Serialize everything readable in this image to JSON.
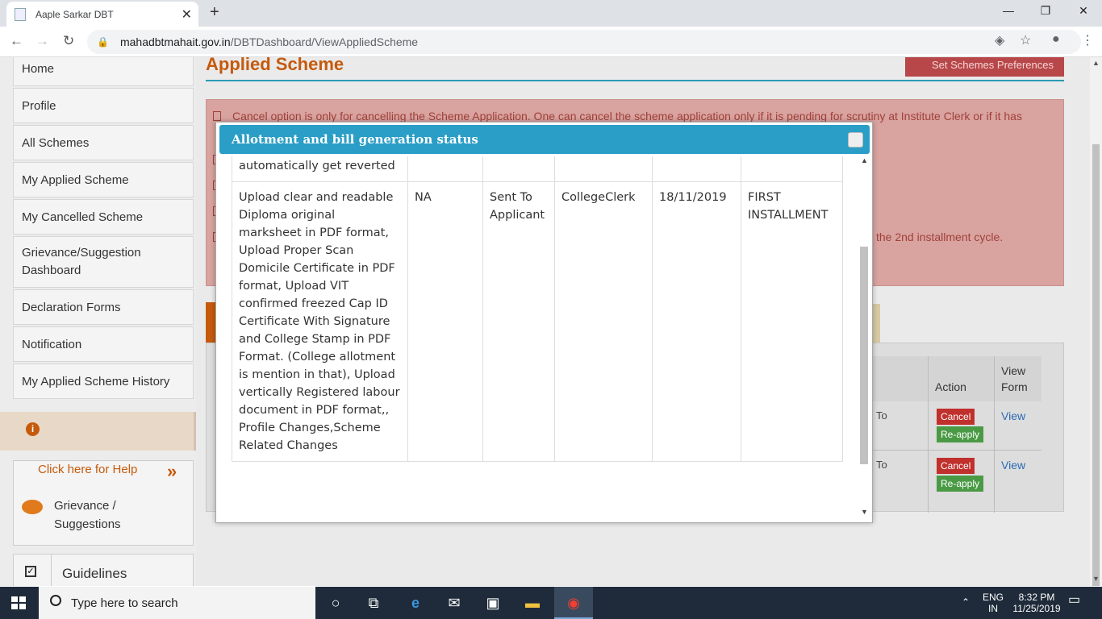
{
  "browser": {
    "tab_title": "Aaple Sarkar DBT",
    "tab_close": "✕",
    "new_tab": "+",
    "url_domain": "mahadbtmahait.gov.in",
    "url_path": "/DBTDashboard/ViewAppliedScheme",
    "window_controls": [
      "—",
      "❐",
      "✕"
    ]
  },
  "sidebar": {
    "items": [
      {
        "label": "Home"
      },
      {
        "label": "Profile"
      },
      {
        "label": "All Schemes"
      },
      {
        "label": "My Applied Scheme"
      },
      {
        "label": "My Cancelled Scheme"
      },
      {
        "label": "Grievance/Suggestion Dashboard"
      },
      {
        "label": "Declaration Forms"
      },
      {
        "label": "Notification"
      },
      {
        "label": "My Applied Scheme History"
      }
    ],
    "help_link": "Click here for Help",
    "help_arrow": "»",
    "grievance_label": "Grievance / Suggestions",
    "guidelines_label": "Guidelines"
  },
  "main": {
    "page_title": "Applied Scheme",
    "prefs_button": "Set Schemes Preferences",
    "notice_text": "Cancel option is only for cancelling the Scheme Application. One can cancel the scheme application only if it is pending for scrutiny at Institute Clerk or if it has",
    "notice_text_2": "the 2nd installment cycle.",
    "table": {
      "headers": {
        "action": "Action",
        "view_form": "View Form"
      },
      "rows": [
        {
          "status_fragment": "To",
          "cancel": "Cancel",
          "reapply": "Re-apply",
          "view": "View"
        },
        {
          "status_fragment": "To",
          "cancel": "Cancel",
          "reapply": "Re-apply",
          "view": "View"
        }
      ]
    }
  },
  "modal": {
    "title": "Allotment and bill generation status",
    "rows": [
      {
        "remark": "automatically get reverted",
        "c2": "",
        "c3": "",
        "c4": "",
        "c5": "",
        "c6": ""
      },
      {
        "remark": "Upload clear and readable Diploma original marksheet in PDF format, Upload Proper Scan Domicile Certificate in PDF format, Upload VIT confirmed freezed Cap ID Certificate With Signature and College Stamp in PDF Format. (College allotment is mention in that), Upload vertically Registered labour document in PDF format,, Profile Changes,Scheme Related Changes",
        "c2": "NA",
        "c3": "Sent To Applicant",
        "c4": "CollegeClerk",
        "c5": "18/11/2019",
        "c6": "FIRST INSTALLMENT"
      }
    ]
  },
  "taskbar": {
    "search_placeholder": "Type here to search",
    "language": "ENG",
    "region": "IN",
    "time": "8:32 PM",
    "date": "11/25/2019"
  }
}
